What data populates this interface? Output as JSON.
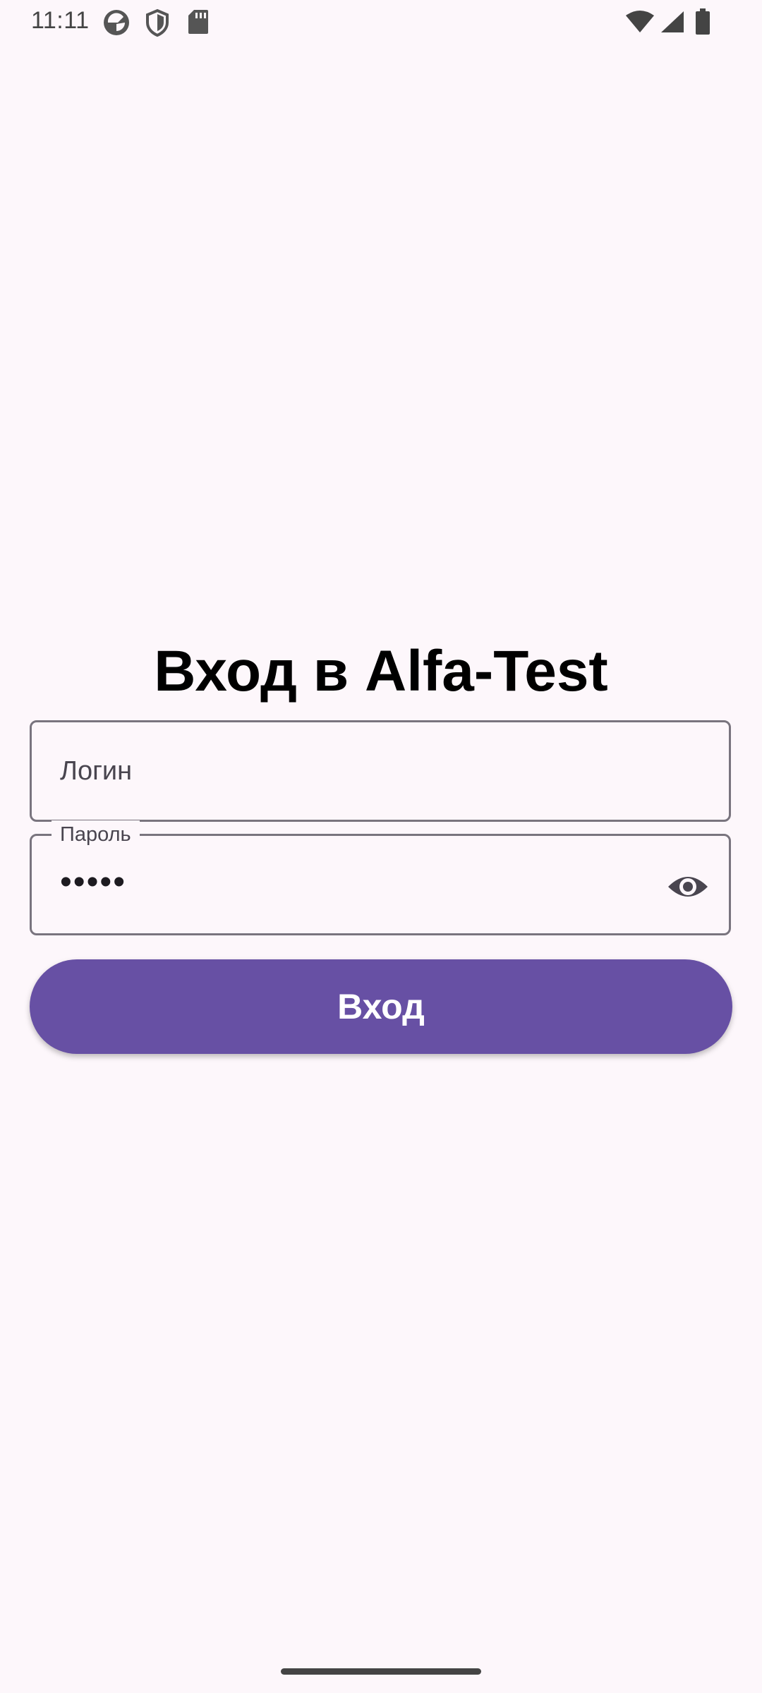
{
  "status_bar": {
    "time": "11:11",
    "left_icons": [
      "app-notification-icon",
      "shield-icon",
      "sd-card-icon"
    ],
    "right_icons": [
      "wifi-icon",
      "cellular-signal-icon",
      "battery-icon"
    ]
  },
  "login_screen": {
    "title": "Вход в Alfa-Test",
    "login_field": {
      "placeholder": "Логин",
      "value": ""
    },
    "password_field": {
      "label": "Пароль",
      "value": "•••••",
      "toggle_icon": "eye-icon"
    },
    "submit_label": "Вход"
  },
  "colors": {
    "background": "#fdf7fb",
    "primary": "#6750a4",
    "outline": "#79747e"
  }
}
